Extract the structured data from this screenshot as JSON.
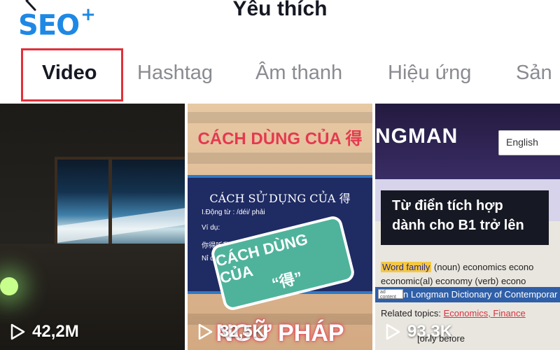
{
  "header": {
    "title": "Yêu thích",
    "logo_text": "SEO",
    "logo_plus": "+",
    "back_icon": "back-chevron-icon"
  },
  "tabs": [
    {
      "label": "Video",
      "active": true
    },
    {
      "label": "Hashtag",
      "active": false
    },
    {
      "label": "Âm thanh",
      "active": false
    },
    {
      "label": "Hiệu ứng",
      "active": false
    },
    {
      "label": "Sản",
      "active": false
    }
  ],
  "videos": [
    {
      "views": "42,2M",
      "play_icon": "play-outline-icon"
    },
    {
      "views": "32,5K",
      "play_icon": "play-outline-icon",
      "overlay": {
        "heading": "CÁCH DÙNG CỦA 得",
        "board_title": "CÁCH SỬ DỤNG CỦA 得",
        "board_lines": [
          "I.Động từ : /déi/ phải",
          "Ví dụ:",
          "你得听我的话。",
          "Nỉ děi tīng wǒ de huà."
        ],
        "bubble_line1": "CÁCH DÙNG CỦA",
        "bubble_line2": "“得”",
        "bottom": "NGỮ PHÁP"
      }
    },
    {
      "views": "93,3K",
      "play_icon": "play-outline-icon",
      "overlay": {
        "brand": "NGMAN",
        "language": "English",
        "headline_line1": "Từ điển tích hợp",
        "headline_line2": "dành cho B1 trở lên",
        "word_family_label": "Word family",
        "word_family_rest": "(noun) economics econo",
        "line2": "economic(al) economy (verb) econo",
        "bluebar": "n Longman Dictionary of Contemporar",
        "tag": "ad content",
        "topics_label": "Related topics:",
        "topics_value": "Economics, Finance",
        "line_tail": "[only before"
      }
    }
  ],
  "colors": {
    "accent_red": "#e0303a",
    "logo_blue": "#1e88e5",
    "tab_active": "#161823",
    "tab_inactive": "#8a8b91"
  }
}
